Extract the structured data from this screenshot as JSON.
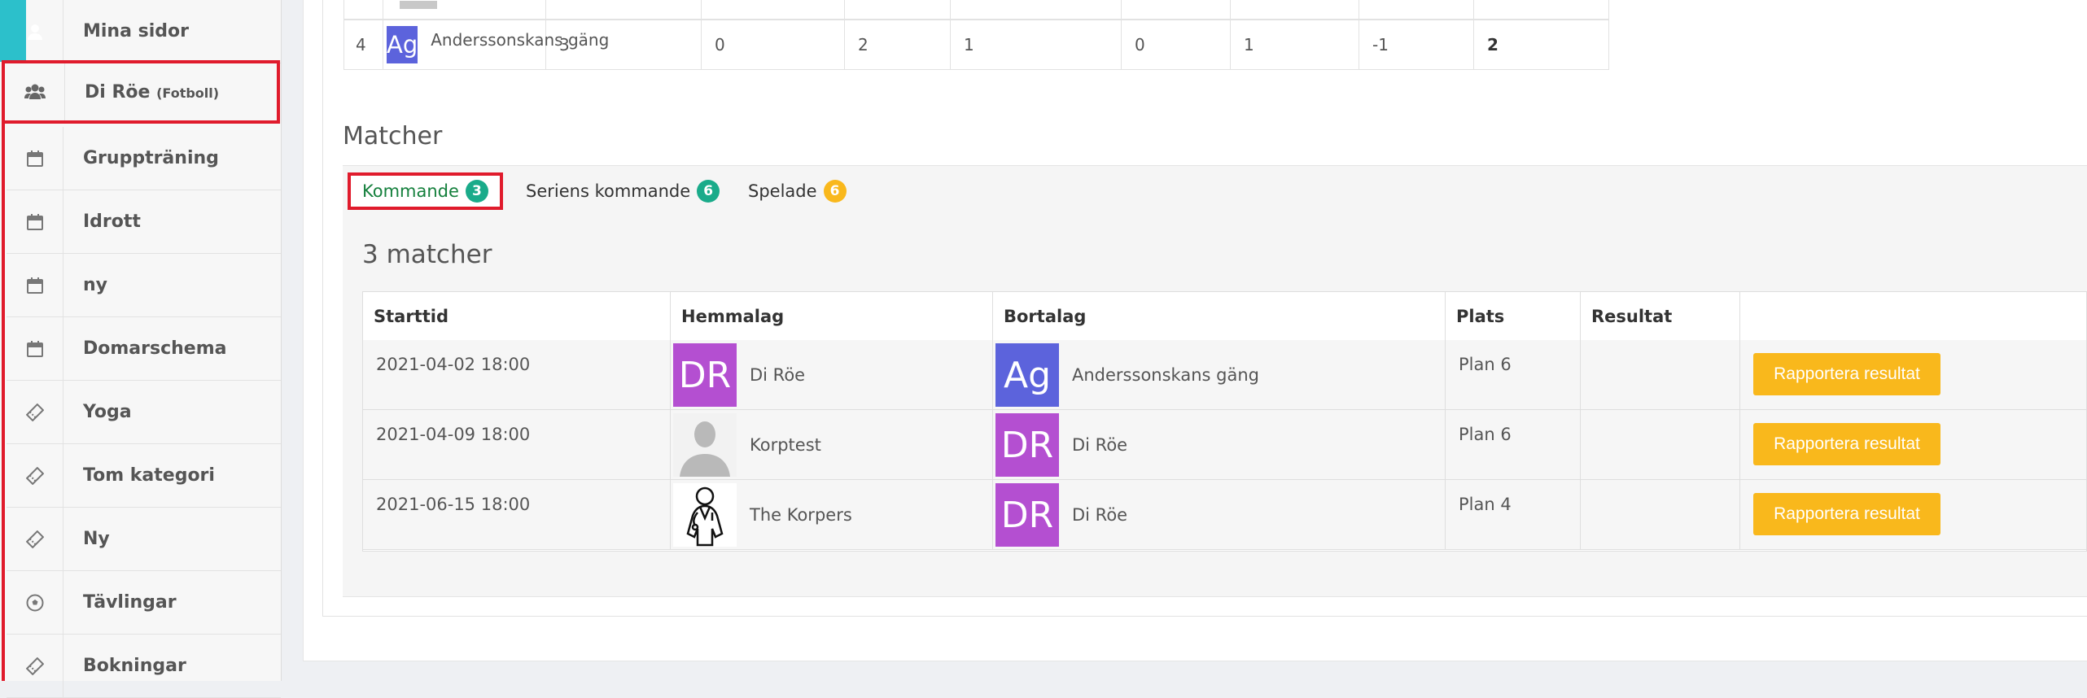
{
  "sidebar": {
    "items": [
      {
        "label": "Mina sidor",
        "icon": "user-icon"
      },
      {
        "label": "Di Röe",
        "sub": "(Fotboll)",
        "icon": "users-icon"
      },
      {
        "label": "Gruppträning",
        "icon": "calendar-icon"
      },
      {
        "label": "Idrott",
        "icon": "calendar-icon"
      },
      {
        "label": "ny",
        "icon": "calendar-icon"
      },
      {
        "label": "Domarschema",
        "icon": "calendar-icon"
      },
      {
        "label": "Yoga",
        "icon": "ticket-icon"
      },
      {
        "label": "Tom kategori",
        "icon": "ticket-icon"
      },
      {
        "label": "Ny",
        "icon": "ticket-icon"
      },
      {
        "label": "Tävlingar",
        "icon": "soccer-ball-icon"
      },
      {
        "label": "Bokningar",
        "icon": "ticket-icon"
      }
    ]
  },
  "standings": {
    "row": {
      "position": "4",
      "avatar": "Ag",
      "team": "Anderssonskans gäng",
      "values": [
        "3",
        "0",
        "2",
        "1",
        "0",
        "1",
        "-1"
      ],
      "points": "2"
    }
  },
  "matches": {
    "title": "Matcher",
    "tabs": [
      {
        "label": "Kommande",
        "count": "3",
        "color": "#1aab8a"
      },
      {
        "label": "Seriens kommande",
        "count": "6",
        "color": "#1aab8a"
      },
      {
        "label": "Spelade",
        "count": "6",
        "color": "#f9b81c"
      }
    ],
    "count_title": "3 matcher",
    "columns": [
      "Starttid",
      "Hemmalag",
      "Bortalag",
      "Plats",
      "Resultat"
    ],
    "rows": [
      {
        "start": "2021-04-02 18:00",
        "home": "Di Röe",
        "home_avatar": "DR",
        "away": "Anderssonskans gäng",
        "away_avatar": "Ag",
        "place": "Plan 6",
        "result": "",
        "action": "Rapportera resultat"
      },
      {
        "start": "2021-04-09 18:00",
        "home": "Korptest",
        "home_avatar": "person-silhouette",
        "away": "Di Röe",
        "away_avatar": "DR",
        "place": "Plan 6",
        "result": "",
        "action": "Rapportera resultat"
      },
      {
        "start": "2021-06-15 18:00",
        "home": "The Korpers",
        "home_avatar": "doctor-icon",
        "away": "Di Röe",
        "away_avatar": "DR",
        "place": "Plan 4",
        "result": "",
        "action": "Rapportera resultat"
      }
    ]
  },
  "colors": {
    "dr_avatar": "#b44fd1",
    "ag_avatar": "#5c63dc",
    "button": "#f9b81c",
    "highlight": "#e01b2c",
    "teal": "#2cc0cb"
  }
}
